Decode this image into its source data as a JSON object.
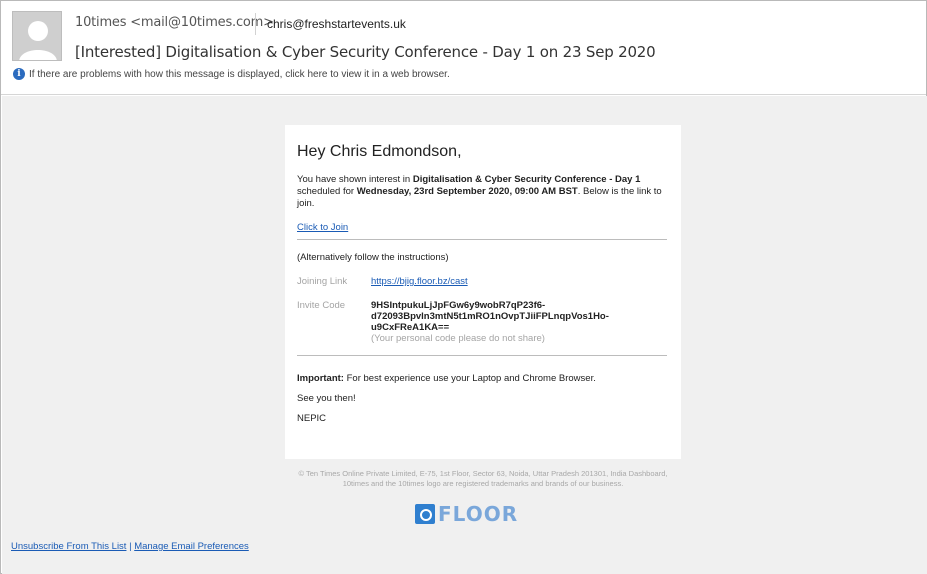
{
  "header": {
    "from": "10times <mail@10times.com>",
    "to": "chris@freshstartevents.uk",
    "subject": "[Interested] Digitalisation & Cyber Security Conference - Day 1 on 23 Sep 2020",
    "info_text": "If there are problems with how this message is displayed, click here to view it in a web browser.",
    "info_icon": "info-icon"
  },
  "email": {
    "greeting": "Hey Chris Edmondson,",
    "para_1": "You have shown interest in ",
    "event_name": "Digitalisation & Cyber Security Conference - Day 1",
    "para_2": " scheduled for ",
    "schedule": "Wednesday, 23rd September 2020, 09:00 AM BST",
    "para_3": ". Below is the link to join.",
    "click_to_join": "Click to Join",
    "alternative": "(Alternatively follow the instructions)",
    "joining_link_label": "Joining Link",
    "joining_link": "https://bjig.floor.bz/cast",
    "invite_code_label": "Invite Code",
    "invite_code": "9HSIntpukuLjJpFGw6y9wobR7qP23f6-d72093Bpvln3mtN5t1mRO1nOvpTJiiFPLnqpVos1Ho-u9CxFReA1KA==",
    "invite_note": "(Your personal code please do not share)",
    "important_label": "Important:",
    "important_text": " For best experience use your Laptop and Chrome Browser.",
    "see_you": "See you then!",
    "signature": "NEPIC"
  },
  "footer": {
    "legal": "© Ten Times Online Private Limited, E-75, 1st Floor, Sector 63, Noida, Uttar Pradesh 201301, India Dashboard, 10times and the 10times logo are registered trademarks and brands of our business.",
    "logo_text": "FLOOR",
    "unsubscribe": "Unsubscribe From This List",
    "pipe": "|",
    "manage_prefs": "Manage Email Preferences"
  },
  "colors": {
    "link": "#1a5bb5",
    "background": "#f0f0f0",
    "info_icon": "#2b6bbf",
    "logo": "#2f7fcf"
  }
}
